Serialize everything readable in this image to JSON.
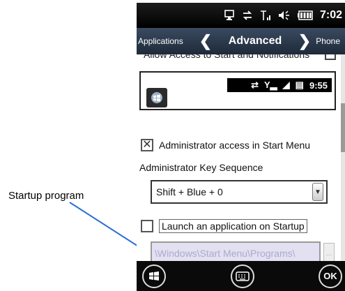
{
  "callout": {
    "label": "Startup program"
  },
  "status_bar": {
    "time": "7:02"
  },
  "nav": {
    "left": "Applications",
    "title": "Advanced",
    "right": "Phone"
  },
  "content": {
    "cut_row_text": "Allow Access to Start and Notifications",
    "preview_time": "9:55",
    "admin_access_label": "Administrator access in Start Menu",
    "admin_access_checked": true,
    "key_sequence_label": "Administrator Key Sequence",
    "key_sequence_value": "Shift + Blue + 0",
    "launch_label": "Launch an application on Startup",
    "launch_checked": false,
    "path_value": "\\Windows\\Start Menu\\Programs\\",
    "browse_label": "..."
  },
  "app_bar": {
    "ok_label": "OK"
  },
  "icons": [
    "windows-start-icon",
    "keyboard-icon",
    "ok-icon",
    "sync-icon",
    "signal-icon",
    "volume-icon",
    "battery-icon",
    "dropdown-arrow-icon"
  ]
}
